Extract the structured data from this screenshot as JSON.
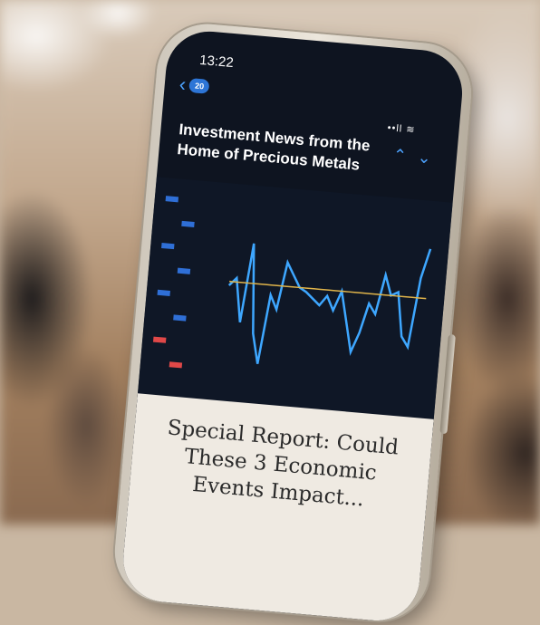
{
  "status": {
    "time": "13:22",
    "icons": "••ll ≋"
  },
  "nav": {
    "back_badge": "20",
    "back_icon": "chevron-left-icon"
  },
  "article": {
    "title": "Investment News from the Home of Precious Metals",
    "headline": "Special Report: Could These 3 Economic Events Impact..."
  },
  "colors": {
    "accent": "#4da3ff",
    "screen_bg": "#0e1420",
    "card_bg": "#efeae2"
  },
  "chart_data": {
    "type": "line",
    "series": [
      {
        "values": [
          58,
          62,
          40,
          80,
          35,
          20,
          55,
          48,
          72,
          66,
          60,
          58,
          55,
          52,
          57,
          50,
          60,
          45,
          30,
          40,
          55,
          50,
          70,
          60,
          62,
          40,
          35,
          70,
          85
        ]
      },
      {
        "values": [
          60,
          60,
          60,
          60,
          60,
          60,
          60,
          60,
          60,
          60,
          60,
          60,
          60,
          60,
          60,
          60,
          60,
          60,
          60,
          60,
          60,
          60,
          60,
          60,
          60,
          60,
          60,
          60,
          60
        ]
      }
    ]
  }
}
